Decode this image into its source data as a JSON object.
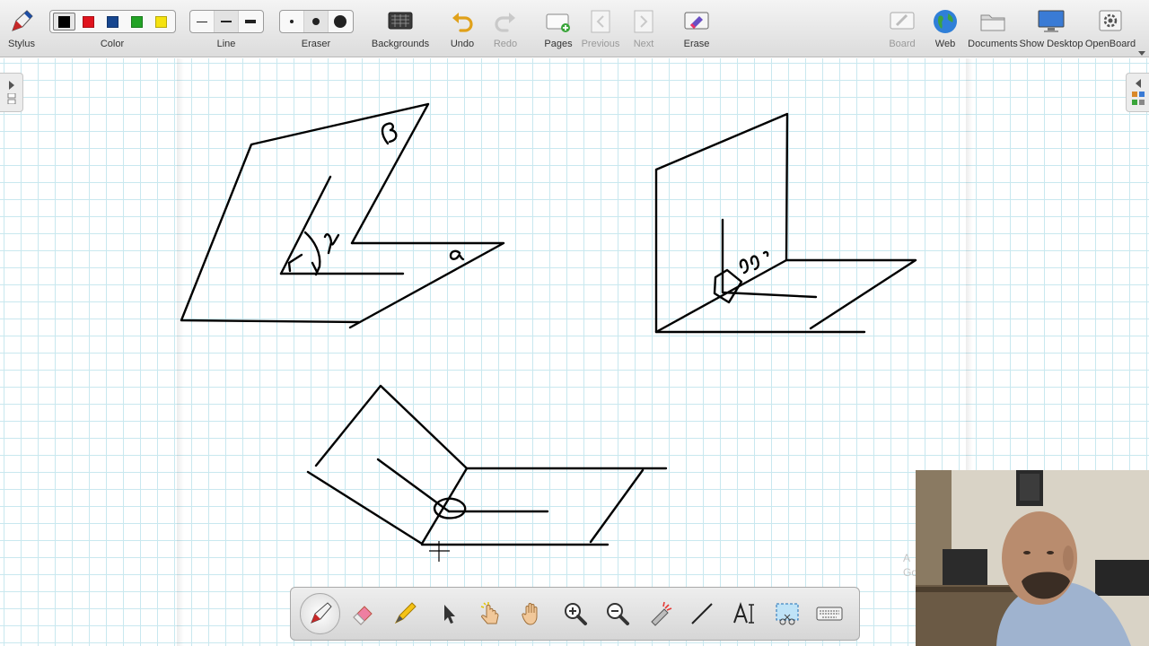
{
  "toolbar": {
    "stylus_label": "Stylus",
    "color_label": "Color",
    "line_label": "Line",
    "eraser_label": "Eraser",
    "backgrounds_label": "Backgrounds",
    "undo_label": "Undo",
    "redo_label": "Redo",
    "pages_label": "Pages",
    "previous_label": "Previous",
    "next_label": "Next",
    "erase_label": "Erase",
    "board_label": "Board",
    "web_label": "Web",
    "documents_label": "Documents",
    "show_desktop_label": "Show Desktop",
    "openboard_label": "OpenBoard",
    "colors": [
      "#000000",
      "#e0141e",
      "#17468f",
      "#23a326",
      "#f5e20f"
    ]
  },
  "drawing": {
    "stroke_color": "#000000",
    "labels": {
      "beta": "β",
      "gamma": "γ",
      "alpha": "α",
      "right_angle": "90°"
    }
  },
  "dock": {
    "tools": [
      "pen-tool",
      "eraser-tool",
      "highlighter-tool",
      "selector-tool",
      "interact-tool",
      "hand-tool",
      "zoom-in-tool",
      "zoom-out-tool",
      "laser-pointer-tool",
      "line-tool",
      "text-tool",
      "capture-tool",
      "virtual-keyboard-tool"
    ]
  },
  "watermark": {
    "line1": "A",
    "line2": "Go"
  }
}
